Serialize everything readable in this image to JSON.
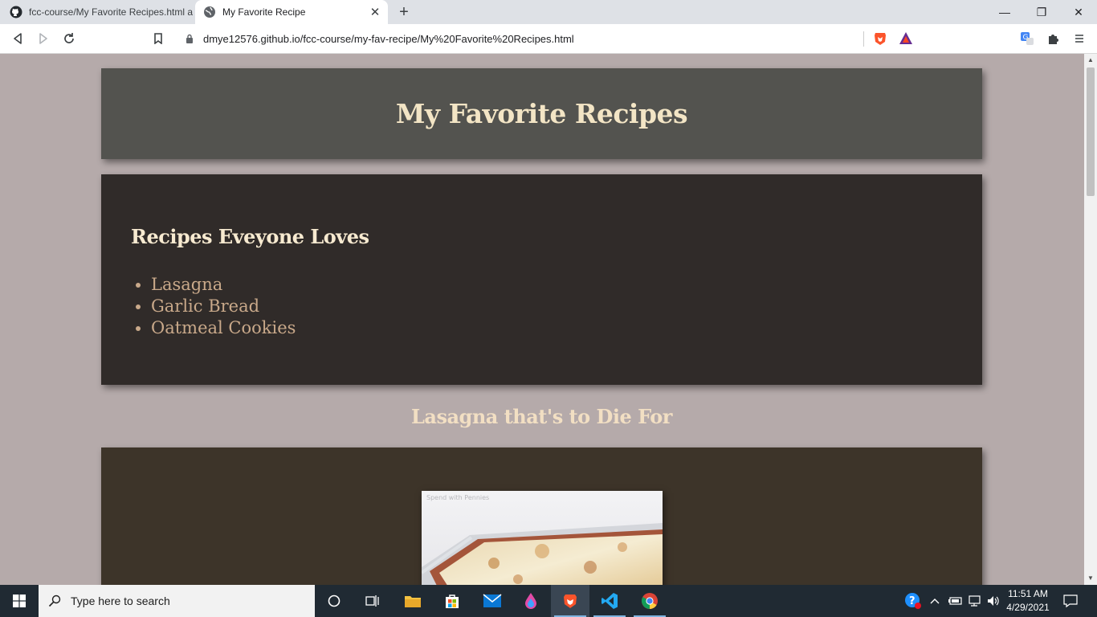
{
  "browser": {
    "tabs": [
      {
        "title": "fcc-course/My Favorite Recipes.html at",
        "icon": "github-icon",
        "active": false
      },
      {
        "title": "My Favorite Recipe",
        "icon": "globe-icon",
        "active": true
      }
    ],
    "new_tab_label": "+",
    "url": "dmye12576.github.io/fcc-course/my-fav-recipe/My%20Favorite%20Recipes.html"
  },
  "page": {
    "title": "My Favorite Recipes",
    "list_heading": "Recipes Eveyone Loves",
    "recipes": [
      "Lasagna",
      "Garlic Bread",
      "Oatmeal Cookies"
    ],
    "section_title": "Lasagna that's to Die For",
    "image_watermark": "Spend with Pennies",
    "colors": {
      "background": "#b5aaaa",
      "header": "#53534f",
      "list_card": "#302b29",
      "photo_card": "#3d3429",
      "title_text": "#f3e5c5",
      "link_text": "#c9a98a"
    }
  },
  "taskbar": {
    "search_placeholder": "Type here to search",
    "time": "11:51 AM",
    "date": "4/29/2021"
  }
}
